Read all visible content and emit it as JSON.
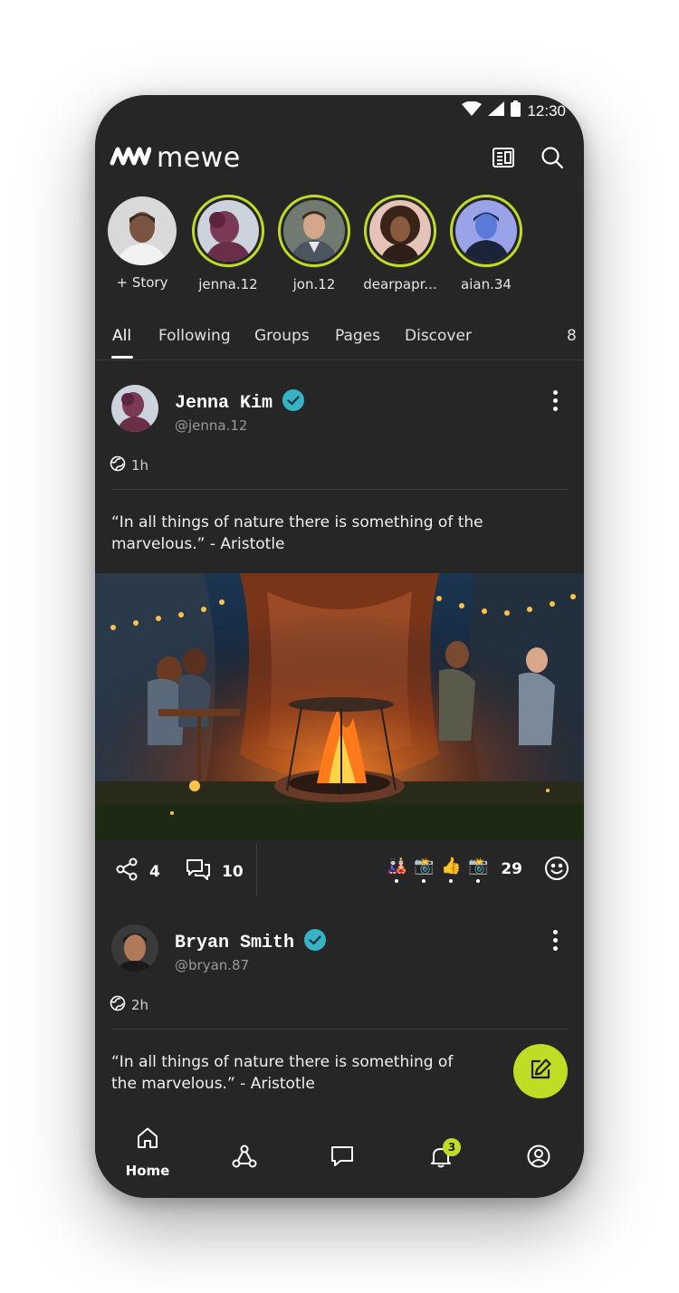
{
  "status_bar": {
    "time": "12:30"
  },
  "app": {
    "logo_text": "mewe"
  },
  "stories": [
    {
      "label": "+ Story"
    },
    {
      "label": "jenna.12"
    },
    {
      "label": "jon.12"
    },
    {
      "label": "dearpapr..."
    },
    {
      "label": "aian.34"
    }
  ],
  "tabs": [
    {
      "label": "All"
    },
    {
      "label": "Following"
    },
    {
      "label": "Groups"
    },
    {
      "label": "Pages"
    },
    {
      "label": "Discover"
    },
    {
      "label": "8"
    }
  ],
  "posts": [
    {
      "name": "Jenna Kim",
      "handle": "@jenna.12",
      "time": "1h",
      "text": "“In all things of nature there is something of the marvelous.” - Aristotle",
      "shares": "4",
      "comments": "10",
      "reactions": [
        "🎎",
        "📸",
        "👍",
        "📸"
      ],
      "reaction_count": "29"
    },
    {
      "name": "Bryan Smith",
      "handle": "@bryan.87",
      "time": "2h",
      "text": "“In all things of nature there is something of the marvelous.” - Aristotle"
    }
  ],
  "bottom_nav": {
    "home_label": "Home",
    "notification_badge": "3"
  },
  "colors": {
    "accent": "#c1dc24",
    "verified": "#38b2c6",
    "background": "#262626"
  },
  "icons": [
    "wifi-icon",
    "signal-icon",
    "battery-icon",
    "newspaper-icon",
    "search-icon",
    "globe-icon",
    "share-icon",
    "comment-icon",
    "smiley-icon",
    "edit-icon",
    "home-icon",
    "network-icon",
    "chat-icon",
    "bell-icon",
    "profile-icon",
    "verified-icon",
    "more-icon"
  ]
}
